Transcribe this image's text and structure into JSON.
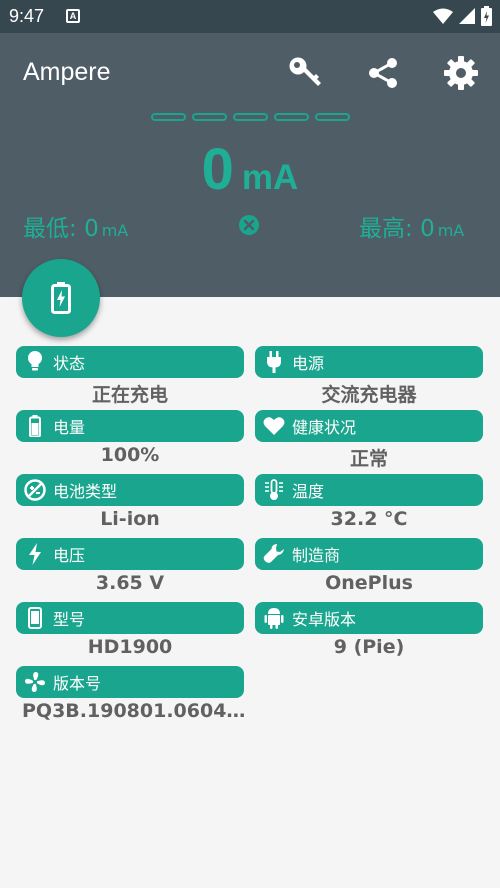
{
  "status_bar": {
    "time": "9:47",
    "notification_icon": "A"
  },
  "app": {
    "title": "Ampere"
  },
  "toolbar": {
    "icons": [
      "key-icon",
      "share-icon",
      "settings-icon"
    ]
  },
  "reading": {
    "value": "0",
    "unit": "mA"
  },
  "minimum": {
    "label": "最低:",
    "value": "0",
    "unit": "mA"
  },
  "maximum": {
    "label": "最高:",
    "value": "0",
    "unit": "mA"
  },
  "info": [
    {
      "icon": "bulb-icon",
      "label": "状态",
      "value": "正在充电"
    },
    {
      "icon": "plug-icon",
      "label": "电源",
      "value": "交流充电器"
    },
    {
      "icon": "battery-level-icon",
      "label": "电量",
      "value": "100%"
    },
    {
      "icon": "heart-icon",
      "label": "健康状况",
      "value": "正常"
    },
    {
      "icon": "battery-type-icon",
      "label": "电池类型",
      "value": "Li-ion"
    },
    {
      "icon": "thermometer-icon",
      "label": "温度",
      "value": "32.2 °C"
    },
    {
      "icon": "lightning-icon",
      "label": "电压",
      "value": "3.65 V"
    },
    {
      "icon": "wrench-icon",
      "label": "制造商",
      "value": "OnePlus"
    },
    {
      "icon": "phone-icon",
      "label": "型号",
      "value": "HD1900"
    },
    {
      "icon": "android-icon",
      "label": "安卓版本",
      "value": "9 (Pie)"
    },
    {
      "icon": "fan-icon",
      "label": "版本号",
      "value": "PQ3B.190801.0604…"
    }
  ],
  "colors": {
    "header": "#4f5d67",
    "status_bar": "#37474f",
    "accent": "#1aa68e",
    "background": "#f5f5f5",
    "value_text": "#616161"
  }
}
